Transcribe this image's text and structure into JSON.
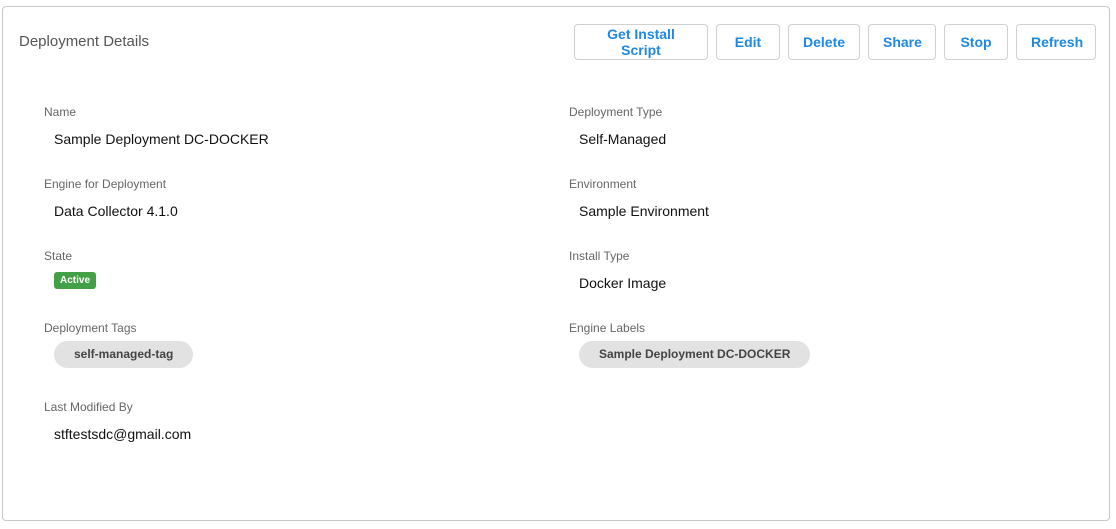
{
  "header": {
    "title": "Deployment Details"
  },
  "toolbar": {
    "get_install_script": "Get Install Script",
    "edit": "Edit",
    "delete": "Delete",
    "share": "Share",
    "stop": "Stop",
    "refresh": "Refresh"
  },
  "details": {
    "name": {
      "label": "Name",
      "value": "Sample Deployment DC-DOCKER"
    },
    "deployment_type": {
      "label": "Deployment Type",
      "value": "Self-Managed"
    },
    "engine": {
      "label": "Engine for Deployment",
      "value": "Data Collector 4.1.0"
    },
    "environment": {
      "label": "Environment",
      "value": "Sample Environment"
    },
    "state": {
      "label": "State",
      "value": "Active",
      "color": "#43a047"
    },
    "install_type": {
      "label": "Install Type",
      "value": "Docker Image"
    },
    "deployment_tags": {
      "label": "Deployment Tags",
      "chips": [
        "self-managed-tag"
      ]
    },
    "engine_labels": {
      "label": "Engine Labels",
      "chips": [
        "Sample Deployment DC-DOCKER"
      ]
    },
    "last_modified_by": {
      "label": "Last Modified By",
      "value": "stftestsdc@gmail.com"
    }
  },
  "colors": {
    "accent": "#1e88e5",
    "active_badge": "#43a047",
    "chip_bg": "#e2e2e2"
  }
}
